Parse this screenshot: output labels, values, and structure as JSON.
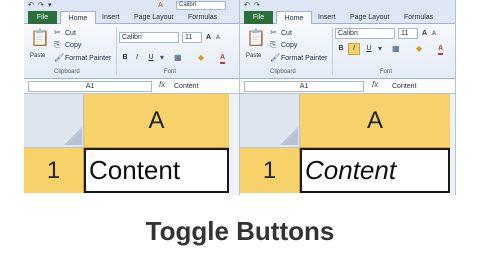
{
  "caption": "Toggle Buttons",
  "panes": [
    {
      "id": "left",
      "qat": {
        "font_box": "Calibri"
      },
      "tabs": {
        "file": "File",
        "home": "Home",
        "insert": "Insert",
        "page_layout": "Page Layout",
        "formulas": "Formulas"
      },
      "ribbon": {
        "paste": "Paste",
        "cut": "Cut",
        "copy": "Copy",
        "format_painter": "Format Painter",
        "font_name": "Calibri",
        "font_size": "11",
        "bold": "B",
        "italic": "I",
        "underline": "U",
        "font_color_letter": "A",
        "grow_font": "A",
        "shrink_font": "A",
        "italic_pressed": false,
        "group_clipboard": "Clipboard",
        "group_font": "Font"
      },
      "formula_bar": {
        "name_box": "A1",
        "fx": "fx",
        "content": "Content"
      },
      "grid": {
        "column": "A",
        "row": "1",
        "cell_value": "Content",
        "cell_italic": false
      }
    },
    {
      "id": "right",
      "tabs": {
        "file": "File",
        "home": "Home",
        "insert": "Insert",
        "page_layout": "Page Layout",
        "formulas": "Formulas"
      },
      "ribbon": {
        "paste": "Paste",
        "cut": "Cut",
        "copy": "Copy",
        "format_painter": "Format Painter",
        "font_name": "Calibri",
        "font_size": "11",
        "bold": "B",
        "italic": "I",
        "underline": "U",
        "font_color_letter": "A",
        "grow_font": "A",
        "shrink_font": "A",
        "italic_pressed": true,
        "group_clipboard": "Clipboard",
        "group_font": "Font"
      },
      "formula_bar": {
        "name_box": "A1",
        "fx": "fx",
        "content": "Content"
      },
      "grid": {
        "column": "A",
        "row": "1",
        "cell_value": "Content",
        "cell_italic": true
      }
    }
  ],
  "colors": {
    "header_highlight": "#f7d16a",
    "file_tab": "#2b6f3a",
    "ribbon_bg": "#dfe8f5"
  }
}
